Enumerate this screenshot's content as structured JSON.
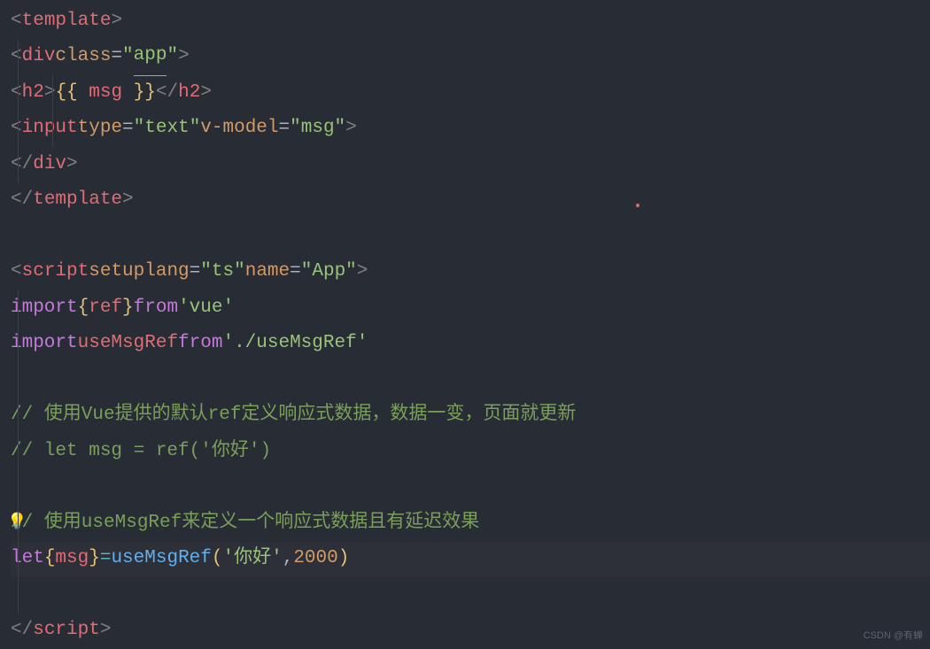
{
  "code": {
    "l1": {
      "tag": "template"
    },
    "l2": {
      "tag": "div",
      "attr": "class",
      "val": "app"
    },
    "l3": {
      "tag": "h2",
      "expr": "msg "
    },
    "l4": {
      "tag": "input",
      "attr1": "type",
      "val1": "text",
      "attr2": "v-model",
      "val2": "msg"
    },
    "l5": {
      "tag": "div"
    },
    "l6": {
      "tag": "template"
    },
    "l8": {
      "tag": "script",
      "attr1": "setup",
      "attr2": "lang",
      "val2": "ts",
      "attr3": "name",
      "val3": "App"
    },
    "l9": {
      "kw": "import",
      "var": "ref",
      "from": "from",
      "str": "'vue'"
    },
    "l10": {
      "kw": "import",
      "var": "useMsgRef",
      "from": "from",
      "str": "'./useMsgRef'"
    },
    "l12": {
      "comment": "// 使用Vue提供的默认ref定义响应式数据，数据一变，页面就更新"
    },
    "l13": {
      "comment": "// let msg = ref('你好')"
    },
    "l15": {
      "comment": "// 使用useMsgRef来定义一个响应式数据且有延迟效果"
    },
    "l16": {
      "kw": "let",
      "var": "msg",
      "fn": "useMsgRef",
      "arg1": "'你好'",
      "arg2": "2000"
    },
    "l18": {
      "tag": "script"
    }
  },
  "watermark": "CSDN @有蝉"
}
